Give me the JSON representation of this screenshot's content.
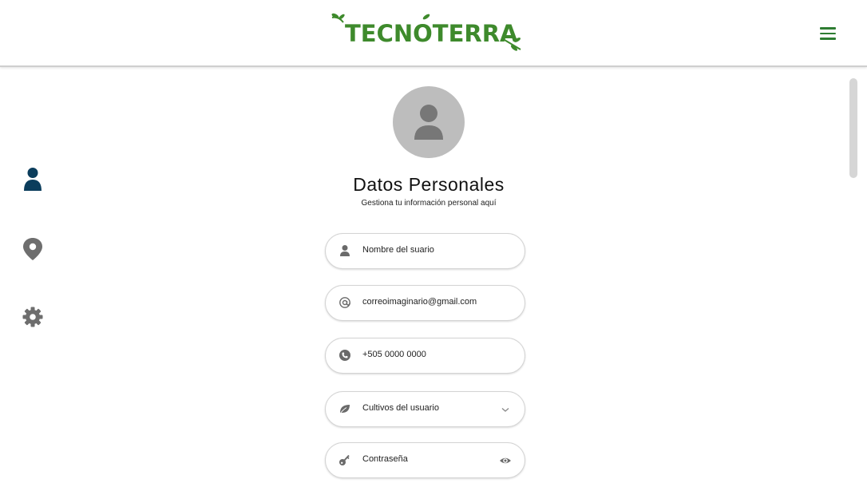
{
  "header": {
    "brand": "TECNOTERRA",
    "menu_icon": "hamburger-menu-icon"
  },
  "sidebar": {
    "items": [
      {
        "icon": "user-icon",
        "color": "#0b3d5c",
        "active": true
      },
      {
        "icon": "map-pin-icon",
        "color": "#6e6e6e",
        "active": false
      },
      {
        "icon": "gear-icon",
        "color": "#6e6e6e",
        "active": false
      }
    ]
  },
  "profile": {
    "title": "Datos Personales",
    "subtitle": "Gestiona tu información personal aquí"
  },
  "form": {
    "username": {
      "value": "Nombre del suario",
      "icon": "user-icon"
    },
    "email": {
      "value": "correoimaginario@gmail.com",
      "icon": "at-icon"
    },
    "phone": {
      "value": "+505 0000 0000",
      "icon": "phone-icon"
    },
    "crops": {
      "value": "Cultivos del usuario",
      "icon": "leaf-icon"
    },
    "password": {
      "value": "Contraseña",
      "icon": "key-icon"
    }
  },
  "colors": {
    "brand_green": "#3e8a2c",
    "active_icon": "#0b3d5c",
    "inactive_icon": "#6e6e6e"
  }
}
